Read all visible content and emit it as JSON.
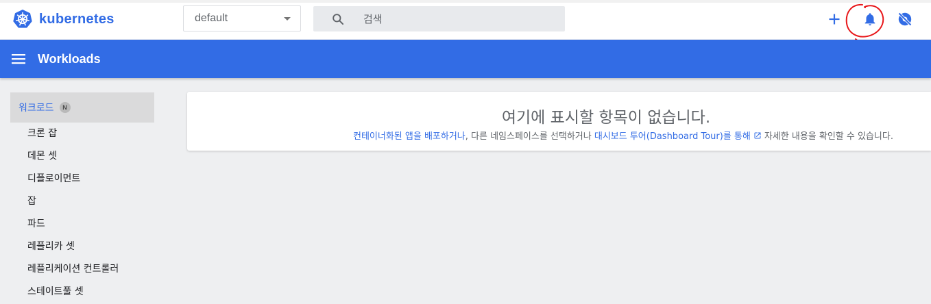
{
  "header": {
    "brand": "kubernetes",
    "namespace_value": "default",
    "search_placeholder": "검색"
  },
  "toolbar": {
    "title": "Workloads"
  },
  "sidebar": {
    "active": {
      "label": "워크로드",
      "badge": "N"
    },
    "items": [
      {
        "label": "크론 잡"
      },
      {
        "label": "데몬 셋"
      },
      {
        "label": "디플로이먼트"
      },
      {
        "label": "잡"
      },
      {
        "label": "파드"
      },
      {
        "label": "레플리카 셋"
      },
      {
        "label": "레플리케이션 컨트롤러"
      },
      {
        "label": "스테이트풀 셋"
      }
    ]
  },
  "main": {
    "empty_title": "여기에 표시할 항목이 없습니다.",
    "link_deploy": "컨테이너화된 앱을 배포하거나",
    "text_between": ", 다른 네임스페이스를 선택하거나 ",
    "link_tour": "대시보드 투어(Dashboard Tour)를 통해",
    "text_end": "자세한 내용을 확인할 수 있습니다."
  },
  "colors": {
    "accent": "#326ce5",
    "annotation": "#e8181b"
  },
  "icons": {
    "logo": "kubernetes-logo",
    "search": "search-icon",
    "add": "plus-icon",
    "notifications": "bell-icon",
    "settings": "settings-off-icon",
    "menu": "hamburger-icon",
    "external": "open-in-new-icon"
  }
}
